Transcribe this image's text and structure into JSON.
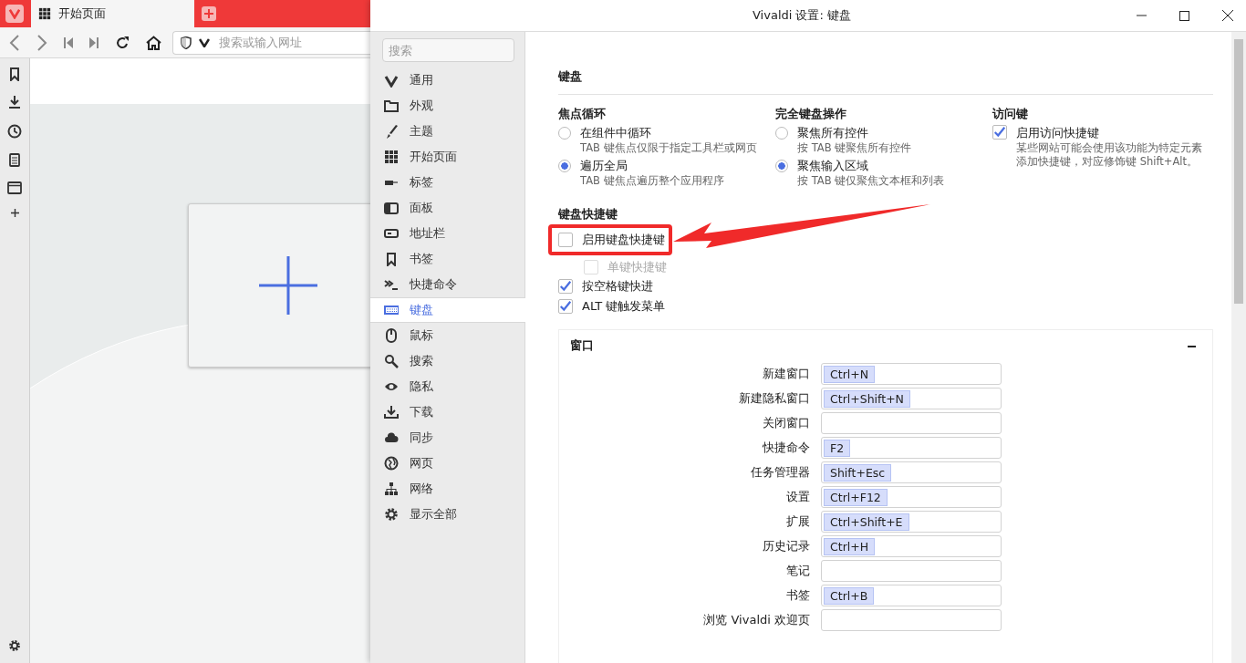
{
  "browser": {
    "tabs": [
      {
        "label": "开始页面",
        "selected": true
      }
    ],
    "address_bar": {
      "placeholder": "搜索或输入网址"
    }
  },
  "settings": {
    "title": "Vivaldi 设置: 键盘",
    "search": {
      "placeholder": "搜索"
    },
    "nav": [
      {
        "label": "通用",
        "selected": false
      },
      {
        "label": "外观",
        "selected": false
      },
      {
        "label": "主题",
        "selected": false
      },
      {
        "label": "开始页面",
        "selected": false
      },
      {
        "label": "标签",
        "selected": false
      },
      {
        "label": "面板",
        "selected": false
      },
      {
        "label": "地址栏",
        "selected": false
      },
      {
        "label": "书签",
        "selected": false
      },
      {
        "label": "快捷命令",
        "selected": false
      },
      {
        "label": "键盘",
        "selected": true
      },
      {
        "label": "鼠标",
        "selected": false
      },
      {
        "label": "搜索",
        "selected": false
      },
      {
        "label": "隐私",
        "selected": false
      },
      {
        "label": "下载",
        "selected": false
      },
      {
        "label": "同步",
        "selected": false
      },
      {
        "label": "网页",
        "selected": false
      },
      {
        "label": "网络",
        "selected": false
      },
      {
        "label": "显示全部",
        "selected": false
      }
    ],
    "section_title": "键盘",
    "groups": [
      {
        "title": "焦点循环",
        "kind": "radio",
        "options": [
          {
            "label": "在组件中循环",
            "description": "TAB 键焦点仅限于指定工具栏或网页",
            "selected": false
          },
          {
            "label": "遍历全局",
            "description": "TAB 键焦点遍历整个应用程序",
            "selected": true
          }
        ]
      },
      {
        "title": "完全键盘操作",
        "kind": "radio",
        "options": [
          {
            "label": "聚焦所有控件",
            "description": "按 TAB 键聚焦所有控件",
            "selected": false
          },
          {
            "label": "聚焦输入区域",
            "description": "按 TAB 键仅聚焦文本框和列表",
            "selected": true
          }
        ]
      },
      {
        "title": "访问键",
        "kind": "checkbox",
        "options": [
          {
            "label": "启用访问快捷键",
            "description": "某些网站可能会使用该功能为特定元素添加快捷键，对应修饰键 Shift+Alt。",
            "checked": true
          }
        ]
      }
    ],
    "shortcuts": {
      "title": "键盘快捷键",
      "options": [
        {
          "label": "启用键盘快捷键",
          "checked": false,
          "disabled": false
        },
        {
          "label": "单键快捷键",
          "checked": false,
          "disabled": true
        },
        {
          "label": "按空格键快进",
          "checked": true,
          "disabled": false
        },
        {
          "label": "ALT 键触发菜单",
          "checked": true,
          "disabled": false
        }
      ]
    },
    "window_panel": {
      "title": "窗口",
      "expanded": true,
      "rows": [
        {
          "label": "新建窗口",
          "keys": [
            "Ctrl+N"
          ]
        },
        {
          "label": "新建隐私窗口",
          "keys": [
            "Ctrl+Shift+N"
          ]
        },
        {
          "label": "关闭窗口",
          "keys": []
        },
        {
          "label": "快捷命令",
          "keys": [
            "F2"
          ]
        },
        {
          "label": "任务管理器",
          "keys": [
            "Shift+Esc"
          ]
        },
        {
          "label": "设置",
          "keys": [
            "Ctrl+F12"
          ]
        },
        {
          "label": "扩展",
          "keys": [
            "Ctrl+Shift+E"
          ]
        },
        {
          "label": "历史记录",
          "keys": [
            "Ctrl+H"
          ]
        },
        {
          "label": "笔记",
          "keys": []
        },
        {
          "label": "书签",
          "keys": [
            "Ctrl+B"
          ]
        },
        {
          "label": "浏览 Vivaldi 欢迎页",
          "keys": []
        }
      ]
    }
  }
}
